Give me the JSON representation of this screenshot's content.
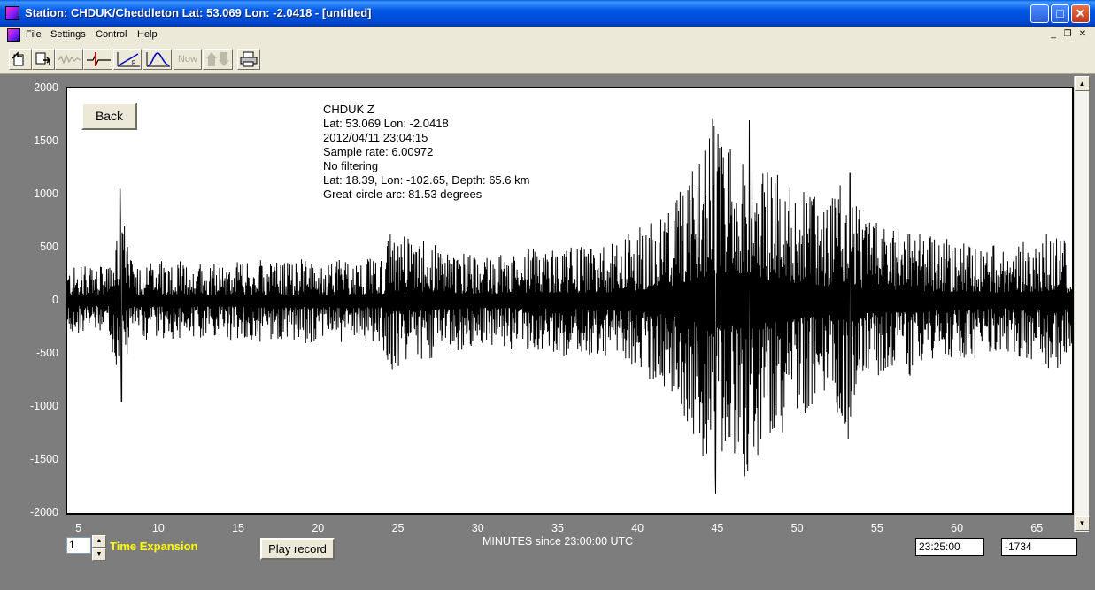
{
  "window": {
    "title": "Station: CHDUK/Cheddleton Lat: 53.069 Lon: -2.0418 - [untitled]"
  },
  "menu": [
    "File",
    "Settings",
    "Control",
    "Help"
  ],
  "toolbar": {
    "now_label": "Now"
  },
  "plot": {
    "back_label": "Back",
    "info": [
      "CHDUK  Z",
      "Lat: 53.069 Lon: -2.0418",
      "2012/04/11 23:04:15",
      "Sample rate: 6.00972",
      "No filtering",
      "Lat: 18.39, Lon: -102.65, Depth: 65.6 km",
      "Great-circle arc: 81.53 degrees"
    ]
  },
  "controls": {
    "time_expansion_value": "1",
    "time_expansion_label": "Time Expansion",
    "play_label": "Play record",
    "cursor_time": "23:25:00",
    "cursor_value": "-1734"
  },
  "chart_data": {
    "type": "line",
    "xlabel": "MINUTES since 23:00:00 UTC",
    "ylabel": "",
    "xlim": [
      4.3,
      67.2
    ],
    "ylim": [
      -2000,
      2000
    ],
    "x_ticks": [
      5,
      10,
      15,
      20,
      25,
      30,
      35,
      40,
      45,
      50,
      55,
      60,
      65
    ],
    "y_ticks": [
      2000,
      1500,
      1000,
      500,
      0,
      -500,
      -1000,
      -1500,
      -2000
    ],
    "series": [
      {
        "envelope_minutes": [
          4.3,
          7.0,
          7.6,
          8.2,
          12,
          18,
          24,
          24.5,
          30,
          35,
          38,
          40,
          41,
          42,
          43,
          44,
          44.8,
          45.5,
          46.5,
          47.2,
          48,
          49,
          50,
          51,
          52,
          53.2,
          54,
          56,
          57.3,
          58,
          60,
          63,
          66.5,
          67.2
        ],
        "envelope_amplitude": [
          320,
          330,
          1050,
          380,
          350,
          380,
          400,
          650,
          420,
          500,
          520,
          650,
          750,
          900,
          1100,
          1400,
          1700,
          1350,
          1650,
          1700,
          1300,
          1200,
          1050,
          1000,
          900,
          1250,
          800,
          650,
          750,
          600,
          550,
          480,
          650,
          400
        ],
        "peaks": [
          {
            "x": 7.6,
            "y": 1050
          },
          {
            "x": 7.7,
            "y": -950
          },
          {
            "x": 44.7,
            "y": 1720
          },
          {
            "x": 44.9,
            "y": -1820
          },
          {
            "x": 47.0,
            "y": 1700
          },
          {
            "x": 46.9,
            "y": -1600
          },
          {
            "x": 53.3,
            "y": 1200
          },
          {
            "x": 53.2,
            "y": -1300
          }
        ]
      }
    ]
  }
}
